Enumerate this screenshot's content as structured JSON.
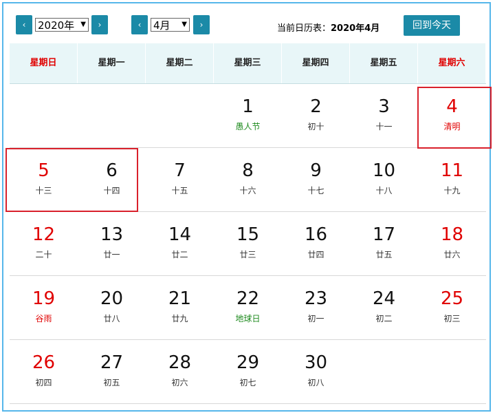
{
  "toolbar": {
    "prev_year": "‹",
    "next_year": "›",
    "year_value": "2020年",
    "prev_month": "‹",
    "next_month": "›",
    "month_value": "4月",
    "dropdown_arrow": "▼",
    "current_label": "当前日历表：",
    "current_value": "2020年4月",
    "today_button": "回到今天"
  },
  "weekdays": [
    "星期日",
    "星期一",
    "星期二",
    "星期三",
    "星期四",
    "星期五",
    "星期六"
  ],
  "weeks": [
    [
      {
        "num": "",
        "lunar": ""
      },
      {
        "num": "",
        "lunar": ""
      },
      {
        "num": "",
        "lunar": ""
      },
      {
        "num": "1",
        "lunar": "愚人节"
      },
      {
        "num": "2",
        "lunar": "初十"
      },
      {
        "num": "3",
        "lunar": "十一"
      },
      {
        "num": "4",
        "lunar": "清明"
      }
    ],
    [
      {
        "num": "5",
        "lunar": "十三"
      },
      {
        "num": "6",
        "lunar": "十四"
      },
      {
        "num": "7",
        "lunar": "十五"
      },
      {
        "num": "8",
        "lunar": "十六"
      },
      {
        "num": "9",
        "lunar": "十七"
      },
      {
        "num": "10",
        "lunar": "十八"
      },
      {
        "num": "11",
        "lunar": "十九"
      }
    ],
    [
      {
        "num": "12",
        "lunar": "二十"
      },
      {
        "num": "13",
        "lunar": "廿一"
      },
      {
        "num": "14",
        "lunar": "廿二"
      },
      {
        "num": "15",
        "lunar": "廿三"
      },
      {
        "num": "16",
        "lunar": "廿四"
      },
      {
        "num": "17",
        "lunar": "廿五"
      },
      {
        "num": "18",
        "lunar": "廿六"
      }
    ],
    [
      {
        "num": "19",
        "lunar": "谷雨"
      },
      {
        "num": "20",
        "lunar": "廿八"
      },
      {
        "num": "21",
        "lunar": "廿九"
      },
      {
        "num": "22",
        "lunar": "地球日"
      },
      {
        "num": "23",
        "lunar": "初一"
      },
      {
        "num": "24",
        "lunar": "初二"
      },
      {
        "num": "25",
        "lunar": "初三"
      }
    ],
    [
      {
        "num": "26",
        "lunar": "初四"
      },
      {
        "num": "27",
        "lunar": "初五"
      },
      {
        "num": "28",
        "lunar": "初六"
      },
      {
        "num": "29",
        "lunar": "初七"
      },
      {
        "num": "30",
        "lunar": "初八"
      },
      {
        "num": "",
        "lunar": ""
      },
      {
        "num": "",
        "lunar": ""
      }
    ]
  ],
  "colors": {
    "accent": "#1b8aa7",
    "weekend": "#e00000",
    "festival": "#1f8b1f",
    "highlight": "#d9202b",
    "header_bg": "#e8f6f8"
  }
}
